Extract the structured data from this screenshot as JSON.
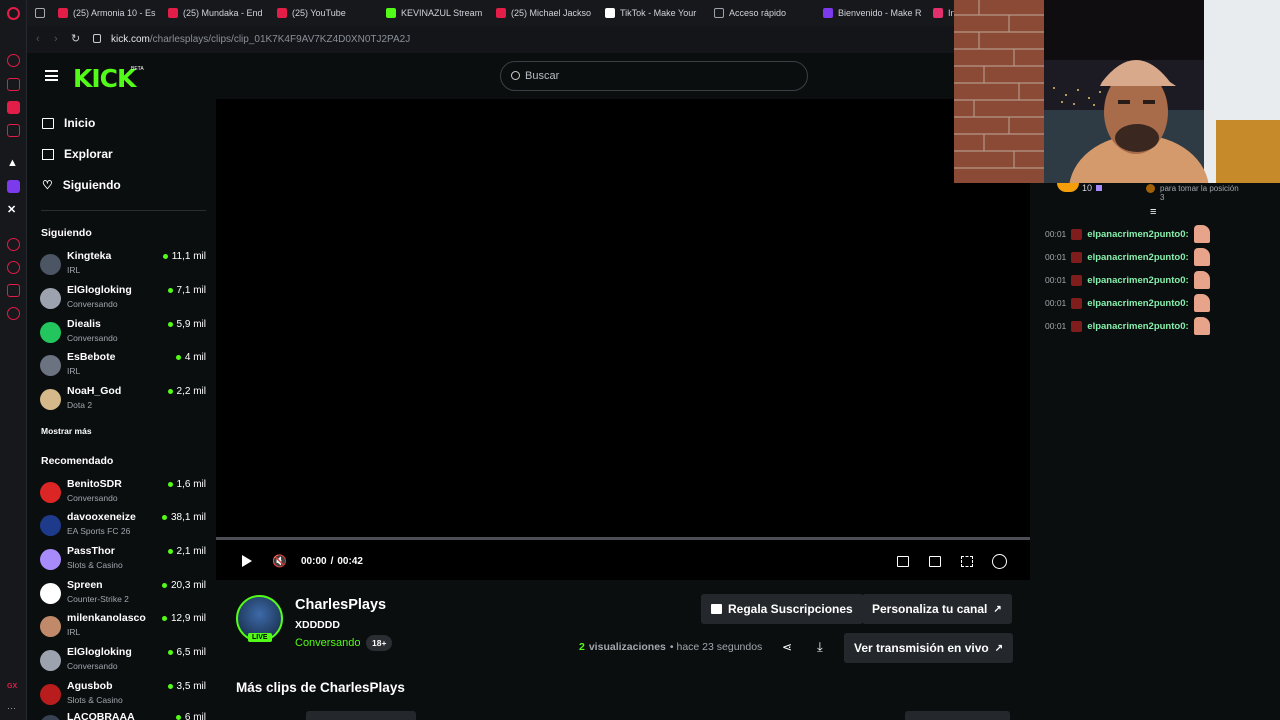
{
  "browser": {
    "bookmarks": [
      {
        "label": "(25) Armonia 10 - Es",
        "color": "#e11d48"
      },
      {
        "label": "(25) Mundaka - End",
        "color": "#e11d48"
      },
      {
        "label": "(25) YouTube",
        "color": "#e11d48"
      },
      {
        "label": "KEVINAZUL Stream",
        "color": "#53fc18"
      },
      {
        "label": "(25) Michael Jackso",
        "color": "#e11d48"
      },
      {
        "label": "TikTok - Make Your",
        "color": "#ffffff"
      },
      {
        "label": "Acceso rápido",
        "color": "#9ca3af"
      },
      {
        "label": "Bienvenido - Make R",
        "color": "#7c3aed"
      },
      {
        "label": "In",
        "color": "#e1306c"
      }
    ],
    "url_host": "kick.com",
    "url_path": "/charlesplays/clips/clip_01K7K4F9AV7KZ4D0XN0TJ2PA2J"
  },
  "header": {
    "logo": "KICK",
    "logo_badge": "BETA",
    "search_placeholder": "Buscar"
  },
  "nav": {
    "inicio": "Inicio",
    "explorar": "Explorar",
    "siguiendo": "Siguiendo"
  },
  "following": {
    "title": "Siguiendo",
    "channels": [
      {
        "name": "Kingteka",
        "category": "IRL",
        "viewers": "11,1 mil"
      },
      {
        "name": "ElGlogloking",
        "category": "Conversando",
        "viewers": "7,1 mil"
      },
      {
        "name": "Diealis",
        "category": "Conversando",
        "viewers": "5,9 mil"
      },
      {
        "name": "EsBebote",
        "category": "IRL",
        "viewers": "4 mil"
      },
      {
        "name": "NoaH_God",
        "category": "Dota 2",
        "viewers": "2,2 mil"
      }
    ],
    "show_more": "Mostrar más"
  },
  "recommended": {
    "title": "Recomendado",
    "channels": [
      {
        "name": "BenitoSDR",
        "category": "Conversando",
        "viewers": "1,6 mil"
      },
      {
        "name": "davooxeneize",
        "category": "EA Sports FC 26",
        "viewers": "38,1 mil"
      },
      {
        "name": "PassThor",
        "category": "Slots & Casino",
        "viewers": "2,1 mil"
      },
      {
        "name": "Spreen",
        "category": "Counter-Strike 2",
        "viewers": "20,3 mil"
      },
      {
        "name": "milenkanolasco",
        "category": "IRL",
        "viewers": "12,9 mil"
      },
      {
        "name": "ElGlogloking",
        "category": "Conversando",
        "viewers": "6,5 mil"
      },
      {
        "name": "Agusbob",
        "category": "Slots & Casino",
        "viewers": "3,5 mil"
      },
      {
        "name": "LACOBRAAA",
        "category": "",
        "viewers": "6 mil"
      }
    ]
  },
  "player": {
    "time_current": "00:00",
    "time_sep": "/",
    "time_total": "00:42",
    "progress": 0.0
  },
  "clip": {
    "channel": "CharlesPlays",
    "title": "XDDDDD",
    "category": "Conversando",
    "rating": "18+",
    "live": "LIVE",
    "views_count": "2",
    "views_label": "visualizaciones",
    "age": "• hace 23 segundos",
    "gift_button": "Regala Suscripciones",
    "customize_button": "Personaliza tu canal",
    "watch_live_button": "Ver transmisión en vivo",
    "more_clips_title": "Más clips de CharlesPlays"
  },
  "chat": {
    "leader_count": "10",
    "position_text": "para tomar la posición",
    "position_num": "3",
    "messages": [
      {
        "time": "00:01",
        "user": "elpanacrimen2punto0:"
      },
      {
        "time": "00:01",
        "user": "elpanacrimen2punto0:"
      },
      {
        "time": "00:01",
        "user": "elpanacrimen2punto0:"
      },
      {
        "time": "00:01",
        "user": "elpanacrimen2punto0:"
      },
      {
        "time": "00:01",
        "user": "elpanacrimen2punto0:"
      }
    ]
  },
  "colors": {
    "accent": "#53fc18",
    "background": "#0b0e0f"
  }
}
